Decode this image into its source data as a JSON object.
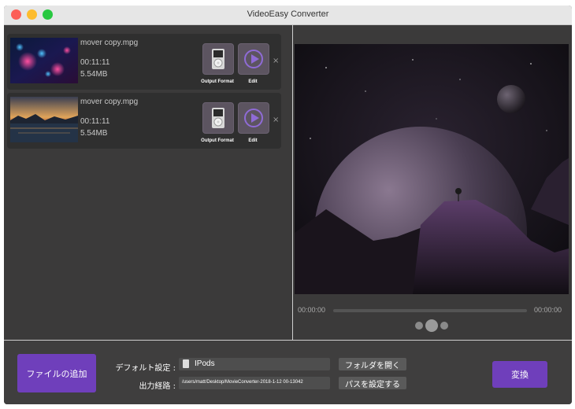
{
  "window": {
    "title": "VideoEasy Converter"
  },
  "files": [
    {
      "name": "mover copy.mpg",
      "duration": "00:11:11",
      "size": "5.54MB",
      "format_label": "Output Format",
      "edit_label": "Edit",
      "remove": "×"
    },
    {
      "name": "mover copy.mpg",
      "duration": "00:11:11",
      "size": "5.54MB",
      "format_label": "Output Format",
      "edit_label": "Edit",
      "remove": "×"
    }
  ],
  "player": {
    "current_time": "00:00:00",
    "total_time": "00:00:00"
  },
  "bottom": {
    "add_file": "ファイルの追加",
    "default_label": "デフォルト設定 :",
    "default_value": "IPods",
    "output_label": "出力経路 :",
    "output_path": "/users/matt/Desktop/MovieConverter-2018-1-12 00-13042",
    "open_folder": "フォルダを開く",
    "set_path": "パスを設定する",
    "convert": "変換"
  },
  "colors": {
    "accent": "#6f3fbb",
    "window_bg": "#3a3939",
    "item_bg": "#2f2f2f"
  },
  "icons": [
    "ipod-format-icon",
    "edit-play-icon",
    "close-icon"
  ]
}
